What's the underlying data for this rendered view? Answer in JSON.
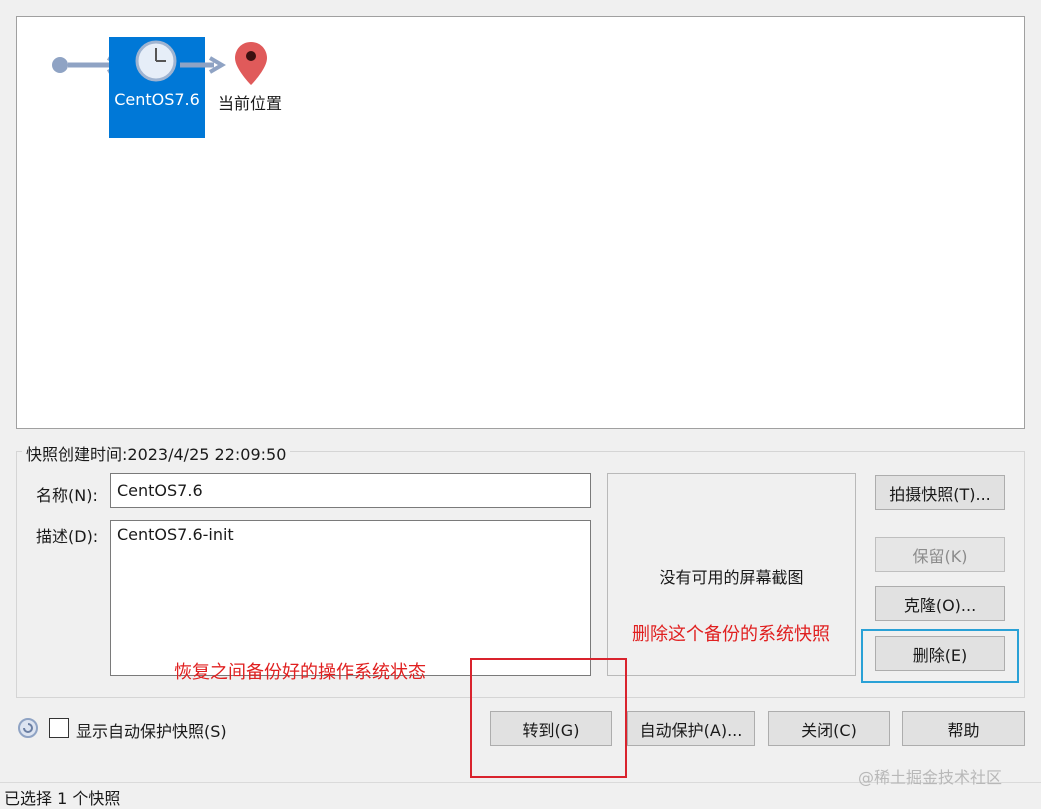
{
  "tree": {
    "snapshot_label": "CentOS7.6",
    "current_position_label": "当前位置"
  },
  "details": {
    "created_label": "快照创建时间:2023/4/25 22:09:50",
    "name_label": "名称(N):",
    "name_value": "CentOS7.6",
    "desc_label": "描述(D):",
    "desc_value": "CentOS7.6-init",
    "no_screenshot": "没有可用的屏幕截图"
  },
  "side_buttons": {
    "take_snapshot": "拍摄快照(T)...",
    "keep": "保留(K)",
    "clone": "克隆(O)...",
    "delete": "删除(E)"
  },
  "bottom": {
    "auto_protect_checkbox_label": "显示自动保护快照(S)",
    "goto": "转到(G)",
    "auto_protect": "自动保护(A)...",
    "close": "关闭(C)",
    "help": "帮助"
  },
  "annotations": {
    "restore": "恢复之间备份好的操作系统状态",
    "delete": "删除这个备份的系统快照"
  },
  "status": {
    "selected": "已选择 1 个快照"
  },
  "watermark": "@稀土掘金技术社区",
  "colors": {
    "selection": "#0078d7",
    "annotation_red": "#e02020",
    "annotation_blue": "#2aa1d6"
  }
}
